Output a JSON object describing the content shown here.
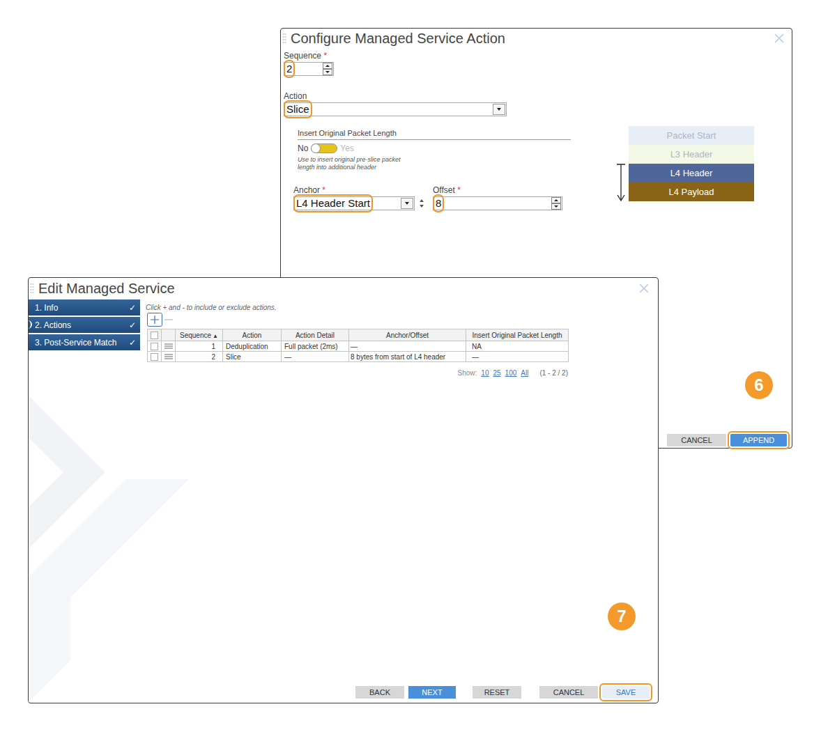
{
  "configure_dialog": {
    "title": "Configure Managed Service Action",
    "sequence": {
      "label": "Sequence",
      "required_mark": "*",
      "value": "2",
      "highlighted": true
    },
    "action": {
      "label": "Action",
      "value": "Slice",
      "highlighted": true
    },
    "insert_original_packet_length": {
      "heading": "Insert Original Packet Length",
      "off_label": "No",
      "on_label": "Yes",
      "on": false,
      "help_lines": [
        "Use to insert original pre-slice packet",
        "length into additional header"
      ]
    },
    "anchor": {
      "label": "Anchor",
      "required_mark": "*",
      "value": "L4 Header Start",
      "highlighted": true
    },
    "offset": {
      "label": "Offset",
      "required_mark": "*",
      "value": "8",
      "highlighted": true
    },
    "packet_layers": [
      {
        "label": "Packet Start",
        "active": false,
        "color": "#e8eef6"
      },
      {
        "label": "L3 Header",
        "active": false,
        "color": "#f4f8e6"
      },
      {
        "label": "L4 Header",
        "active": true,
        "color": "#4f6798"
      },
      {
        "label": "L4 Payload",
        "active": true,
        "color": "#8a6416"
      }
    ],
    "buttons": [
      {
        "label": "CANCEL",
        "kind": "default",
        "highlighted": false
      },
      {
        "label": "APPEND",
        "kind": "primary",
        "highlighted": true
      }
    ],
    "callout": "6"
  },
  "edit_dialog": {
    "title": "Edit Managed Service",
    "steps": [
      {
        "label": "1. Info",
        "check": "✓",
        "selected": false
      },
      {
        "label": "2. Actions",
        "check": "✓",
        "selected": true
      },
      {
        "label": "3. Post-Service Match",
        "check": "✓",
        "selected": false
      }
    ],
    "hint": "Click + and - to include or exclude actions.",
    "table": {
      "header_checked": false,
      "columns": [
        {
          "label": "Sequence",
          "sorted": true,
          "sort_mark": "▲"
        },
        {
          "label": "Action",
          "sorted": false
        },
        {
          "label": "Action Detail",
          "sorted": false
        },
        {
          "label": "Anchor/Offset",
          "sorted": false
        },
        {
          "label": "Insert Original Packet Length",
          "sorted": false
        }
      ],
      "rows": [
        {
          "checked": false,
          "cells": [
            "1",
            "Deduplication",
            "Full packet (2ms)",
            "—",
            "NA"
          ]
        },
        {
          "checked": false,
          "cells": [
            "2",
            "Slice",
            "—",
            "8 bytes from start of L4 header",
            "—"
          ]
        }
      ]
    },
    "pagination": {
      "label": "Show:",
      "sizes": [
        "10",
        "25",
        "100",
        "All"
      ],
      "range": "(1 - 2 / 2)"
    },
    "buttons": [
      {
        "label": "BACK",
        "kind": "default",
        "highlighted": false
      },
      {
        "label": "NEXT",
        "kind": "primary",
        "highlighted": false
      },
      {
        "label": "RESET",
        "kind": "default",
        "highlighted": false
      },
      {
        "label": "CANCEL",
        "kind": "default",
        "highlighted": false
      },
      {
        "label": "SAVE",
        "kind": "light",
        "highlighted": true
      }
    ],
    "callout": "7"
  }
}
